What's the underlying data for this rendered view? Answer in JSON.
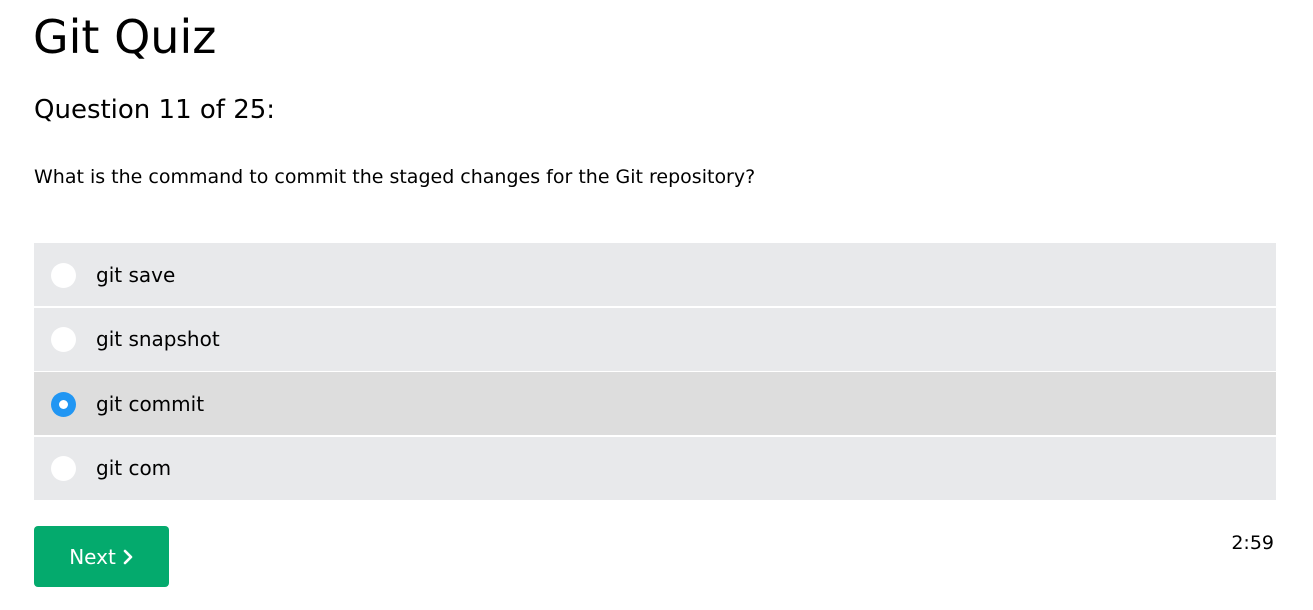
{
  "quiz": {
    "title": "Git Quiz",
    "counter": "Question 11 of 25:",
    "question": "What is the command to commit the staged changes for the Git repository?"
  },
  "options": [
    {
      "label": "git save",
      "selected": false
    },
    {
      "label": "git snapshot",
      "selected": false
    },
    {
      "label": "git commit",
      "selected": true
    },
    {
      "label": "git com",
      "selected": false
    }
  ],
  "next_button": {
    "label": "Next",
    "icon": "chevron-right-icon"
  },
  "timer": "2:59",
  "colors": {
    "accent": "#04aa6d",
    "radio_selected": "#2196f3",
    "option_bg": "#e8e9eb",
    "option_selected_bg": "#dddddd"
  }
}
